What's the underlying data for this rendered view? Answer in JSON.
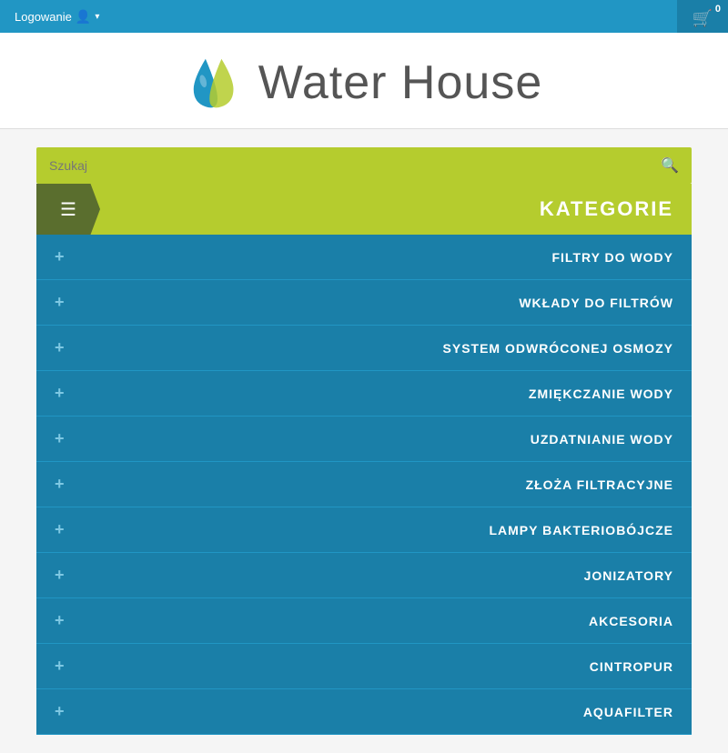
{
  "topbar": {
    "login_label": "Logowanie",
    "cart_count": "0",
    "bg_color": "#2196c4"
  },
  "logo": {
    "text": "Water House"
  },
  "search": {
    "placeholder": "Szukaj"
  },
  "categories": {
    "title": "KATEGORIE",
    "items": [
      {
        "label": "FILTRY DO WODY"
      },
      {
        "label": "WKŁADY DO FILTRÓW"
      },
      {
        "label": "SYSTEM ODWRÓCONEJ OSMOZY"
      },
      {
        "label": "ZMIĘKCZANIE WODY"
      },
      {
        "label": "UZDATNIANIE WODY"
      },
      {
        "label": "ZŁOŻA FILTRACYJNE"
      },
      {
        "label": "LAMPY BAKTERIOBÓJCZE"
      },
      {
        "label": "JONIZATORY"
      },
      {
        "label": "AKCESORIA"
      },
      {
        "label": "CINTROPUR"
      },
      {
        "label": "AQUAFILTER"
      }
    ]
  }
}
